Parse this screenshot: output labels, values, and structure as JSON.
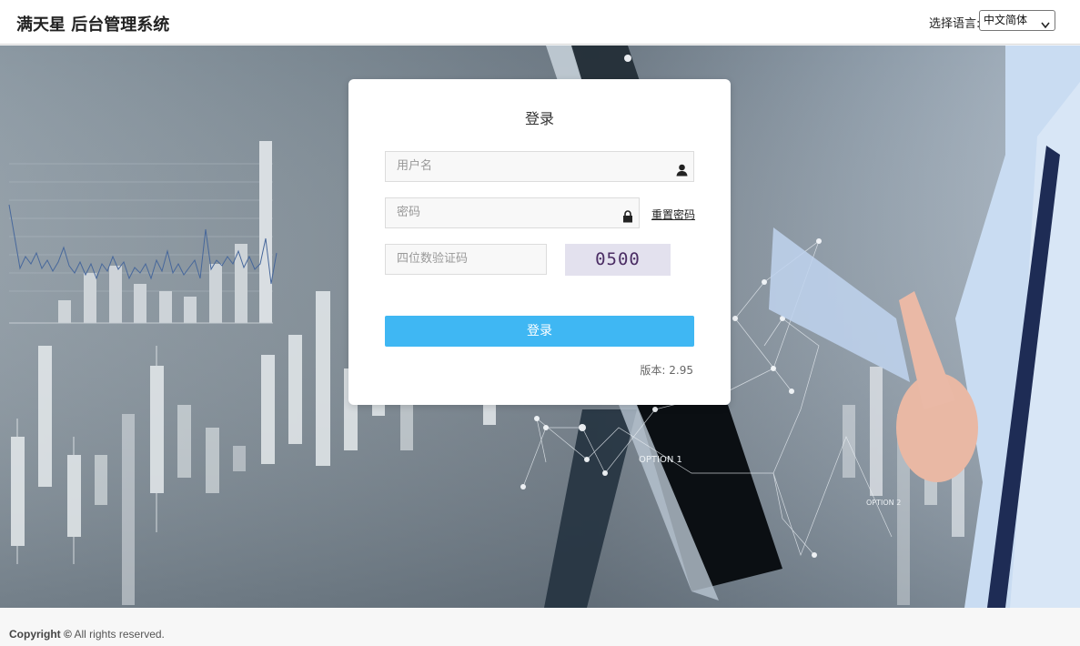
{
  "header": {
    "brand": "满天星 后台管理系统",
    "language_label": "选择语言:",
    "language_selected": "中文简体"
  },
  "login": {
    "title": "登录",
    "username_placeholder": "用户名",
    "password_placeholder": "密码",
    "reset_password_link": "重置密码",
    "captcha_placeholder": "四位数验证码",
    "captcha_code": "0500",
    "submit_label": "登录",
    "version": "版本: 2.95"
  },
  "background": {
    "labels": [
      "OPTION 1",
      "OPTION 2"
    ]
  },
  "footer": {
    "copyright_bold": "Copyright ©",
    "copyright_rest": " All rights reserved."
  },
  "colors": {
    "accent": "#3fb7f3",
    "captcha_bg": "#e3e1ee",
    "captcha_text": "#4b2d64"
  },
  "icons": [
    "user-icon",
    "lock-icon",
    "chevron-down-icon"
  ]
}
